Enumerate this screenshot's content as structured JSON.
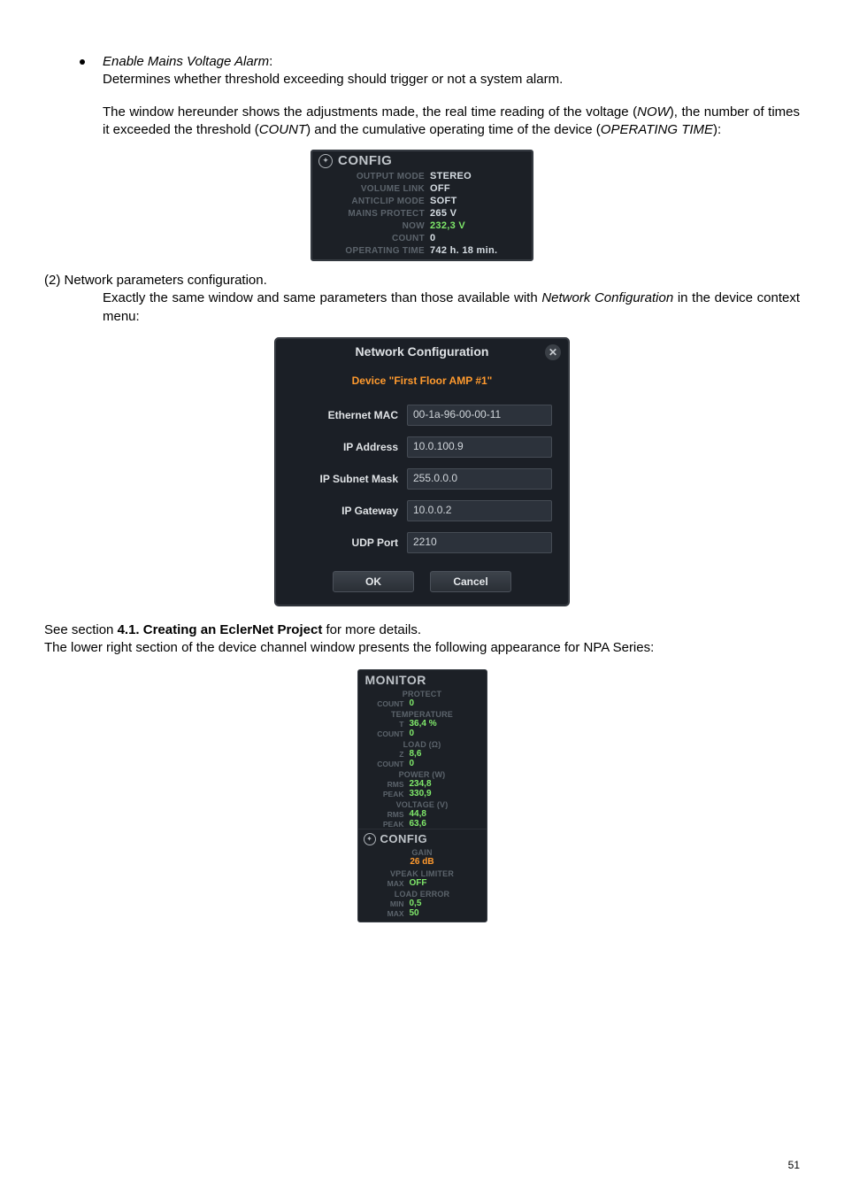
{
  "bullet": {
    "title_italic": "Enable Mains Voltage Alarm",
    "colon": ":",
    "desc": "Determines whether threshold exceeding should trigger or not a system alarm."
  },
  "para1": {
    "pre": "The window hereunder shows the adjustments made, the real time reading of the voltage (",
    "now": "NOW",
    "mid1": "), the number of times it exceeded the threshold (",
    "count": "COUNT",
    "mid2": ") and the cumulative operating time of the device (",
    "optime": "OPERATING TIME",
    "end": "):"
  },
  "config_panel": {
    "title": "CONFIG",
    "icon_glyph": "✦",
    "rows": [
      {
        "label": "OUTPUT MODE",
        "value": "STEREO",
        "green": false
      },
      {
        "label": "VOLUME LINK",
        "value": "OFF",
        "green": false
      },
      {
        "label": "ANTICLIP MODE",
        "value": "SOFT",
        "green": false
      },
      {
        "label": "MAINS PROTECT",
        "value": "265 V",
        "green": false
      },
      {
        "label": "NOW",
        "value": "232,3 V",
        "green": true
      },
      {
        "label": "COUNT",
        "value": "0",
        "green": false
      },
      {
        "label": "OPERATING TIME",
        "value": "742 h. 18 min.",
        "green": false
      }
    ]
  },
  "section2": {
    "num": "(2) Network parameters configuration.",
    "text_pre": "Exactly the same window and same parameters than those available with ",
    "text_em": "Network Configuration",
    "text_post": " in the device context menu:"
  },
  "net_dialog": {
    "title": "Network Configuration",
    "close_glyph": "✕",
    "device_label": "Device \"First Floor AMP #1\"",
    "rows": [
      {
        "label": "Ethernet MAC",
        "value": "00-1a-96-00-00-11"
      },
      {
        "label": "IP Address",
        "value": "10.0.100.9"
      },
      {
        "label": "IP Subnet Mask",
        "value": "255.0.0.0"
      },
      {
        "label": "IP Gateway",
        "value": "10.0.0.2"
      },
      {
        "label": "UDP Port",
        "value": "2210"
      }
    ],
    "ok": "OK",
    "cancel": "Cancel"
  },
  "see_section": {
    "pre": "See section ",
    "bold": "4.1. Creating an EclerNet Project",
    "post": " for more details."
  },
  "lower_text": "The lower right section of the device channel window presents the following appearance for NPA Series:",
  "monitor_panel": {
    "title": "MONITOR",
    "sections": [
      {
        "label": "PROTECT",
        "rows": [
          {
            "k": "COUNT",
            "v": "0"
          }
        ]
      },
      {
        "label": "TEMPERATURE",
        "rows": [
          {
            "k": "T",
            "v": "36,4 %"
          },
          {
            "k": "COUNT",
            "v": "0"
          }
        ]
      },
      {
        "label": "LOAD (Ω)",
        "rows": [
          {
            "k": "Z",
            "v": "8,6"
          },
          {
            "k": "COUNT",
            "v": "0"
          }
        ]
      },
      {
        "label": "POWER (W)",
        "rows": [
          {
            "k": "RMS",
            "v": "234,8"
          },
          {
            "k": "PEAK",
            "v": "330,9"
          }
        ]
      },
      {
        "label": "VOLTAGE (V)",
        "rows": [
          {
            "k": "RMS",
            "v": "44,8"
          },
          {
            "k": "PEAK",
            "v": "63,6"
          }
        ]
      }
    ],
    "config": {
      "title": "CONFIG",
      "icon_glyph": "✦",
      "gain_label": "GAIN",
      "gain_value": "26 dB",
      "vpeak_label": "VPEAK LIMITER",
      "vpeak_rows": [
        {
          "k": "MAX",
          "v": "OFF"
        }
      ],
      "loaderr_label": "LOAD ERROR",
      "loaderr_rows": [
        {
          "k": "MIN",
          "v": "0,5"
        },
        {
          "k": "MAX",
          "v": "50"
        }
      ]
    }
  },
  "page_number": "51"
}
